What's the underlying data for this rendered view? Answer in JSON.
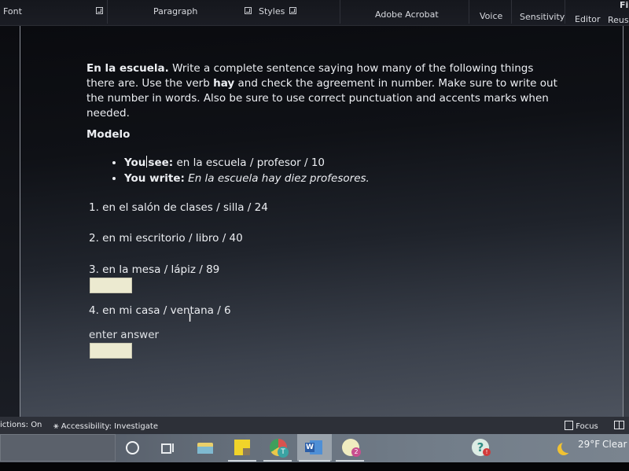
{
  "ribbon": {
    "groups": [
      "Font",
      "Paragraph",
      "Styles",
      "Adobe Acrobat",
      "Voice",
      "Sensitivity",
      "Editor",
      "Reuse Fil"
    ],
    "top_right_fragment": "Fil"
  },
  "document": {
    "intro_bold": "En la escuela.",
    "intro_text_1": " Write a complete sentence saying how many of the following things there are. Use the verb ",
    "intro_verb": "hay",
    "intro_text_2": " and check the agreement in number. Make sure to write out the number in words. Also be sure to use correct punctuation and accents marks when needed.",
    "modelo": "Modelo",
    "example": [
      {
        "label_a": "You",
        "label_b": "see:",
        "text": " en la escuela / profesor / 10"
      },
      {
        "label": "You write:",
        "text": " En la escuela hay diez profesores."
      }
    ],
    "questions": [
      {
        "text": "1. en el salón de clases / silla / 24"
      },
      {
        "text": "2. en mi escritorio / libro / 40"
      },
      {
        "text": "3. en la mesa / lápiz / 89",
        "answer": ""
      },
      {
        "text_a": "4. en mi casa / ven",
        "text_b": "tana / 6",
        "prompt": "enter answer",
        "answer": ""
      }
    ]
  },
  "status_bar": {
    "predictions": "ictions: On",
    "accessibility": "Accessibility: Investigate",
    "focus": "Focus"
  },
  "taskbar": {
    "apps": [
      "cortana",
      "task-view",
      "file-explorer",
      "sticky-notes",
      "chrome",
      "word",
      "app-badge-2",
      "help-alert"
    ],
    "badge_count": "2",
    "weather_temp": "29°F",
    "weather_desc": "Clear"
  },
  "colors": {
    "answer_box": "#ecead0",
    "text": "#eceef2"
  }
}
